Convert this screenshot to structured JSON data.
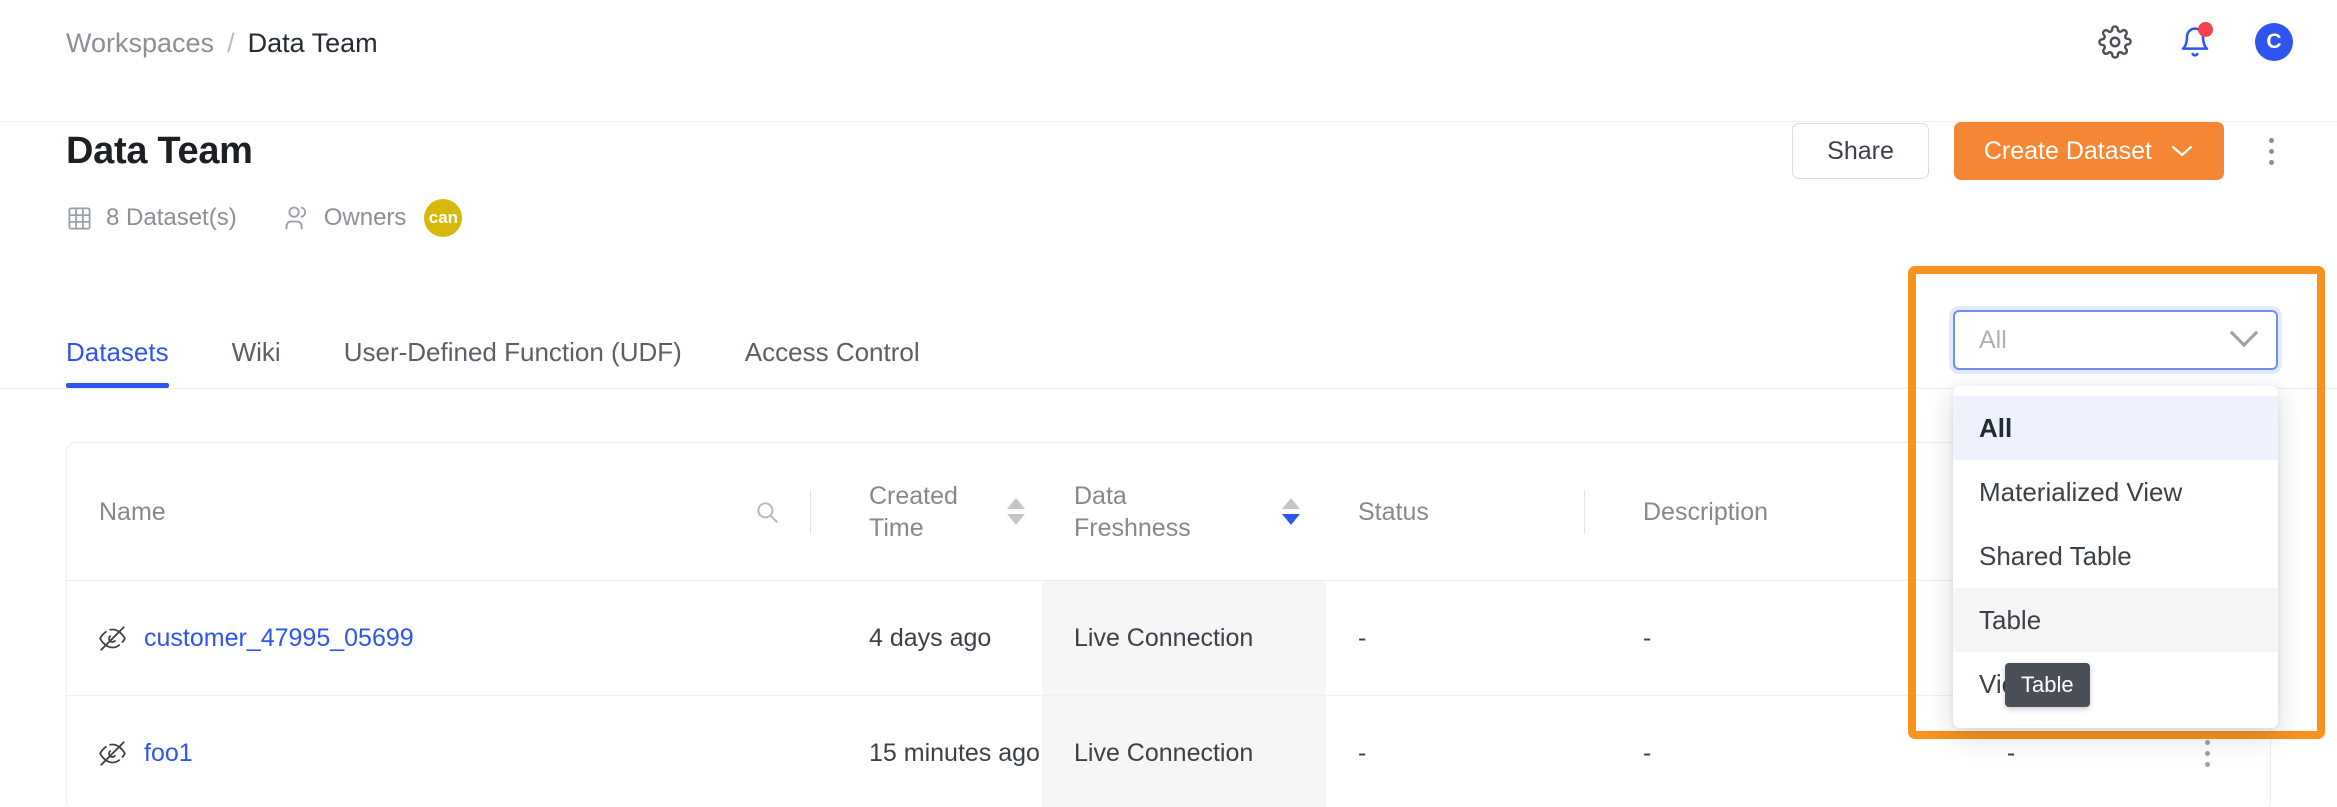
{
  "breadcrumb": {
    "root": "Workspaces",
    "separator": "/",
    "current": "Data Team"
  },
  "topbar": {
    "settings_icon": "gear-icon",
    "notifications_icon": "bell-icon",
    "avatar_initial": "C"
  },
  "page": {
    "title": "Data Team",
    "dataset_count": "8 Dataset(s)",
    "owners_label": "Owners",
    "owner_initials": "can"
  },
  "actions": {
    "share_label": "Share",
    "create_label": "Create Dataset",
    "create_caret": "⌄",
    "more_label": "more-options"
  },
  "tabs": [
    {
      "label": "Datasets",
      "active": true
    },
    {
      "label": "Wiki",
      "active": false
    },
    {
      "label": "User-Defined Function (UDF)",
      "active": false
    },
    {
      "label": "Access Control",
      "active": false
    }
  ],
  "filter": {
    "placeholder": "All",
    "value": "",
    "options": [
      {
        "label": "All",
        "state": "selected"
      },
      {
        "label": "Materialized View",
        "state": "normal"
      },
      {
        "label": "Shared Table",
        "state": "normal"
      },
      {
        "label": "Table",
        "state": "hovered"
      },
      {
        "label": "View",
        "state": "normal"
      }
    ],
    "tooltip": "Table"
  },
  "table": {
    "columns": [
      {
        "key": "name",
        "label": "Name",
        "icon": "search-icon",
        "sortable": false
      },
      {
        "key": "created_time",
        "label": "Created Time",
        "sortable": true,
        "sort": "none"
      },
      {
        "key": "data_freshness",
        "label": "Data Freshness",
        "sortable": true,
        "sort": "desc"
      },
      {
        "key": "status",
        "label": "Status",
        "sortable": false
      },
      {
        "key": "description",
        "label": "Description",
        "sortable": false
      }
    ],
    "rows": [
      {
        "visibility_icon": "eye-off-icon",
        "name": "customer_47995_05699",
        "created_time": "4 days ago",
        "data_freshness": "Live Connection",
        "status": "-",
        "description": "-",
        "extra": "-"
      },
      {
        "visibility_icon": "eye-off-icon",
        "name": "foo1",
        "created_time": "15 minutes ago",
        "data_freshness": "Live Connection",
        "status": "-",
        "description": "-",
        "extra": "-"
      }
    ]
  },
  "colors": {
    "accent_blue": "#2f55f0",
    "accent_orange": "#f58634",
    "highlight_orange": "#F7931E",
    "owner_badge": "#d6b80b",
    "notification_red": "#f5414f"
  }
}
